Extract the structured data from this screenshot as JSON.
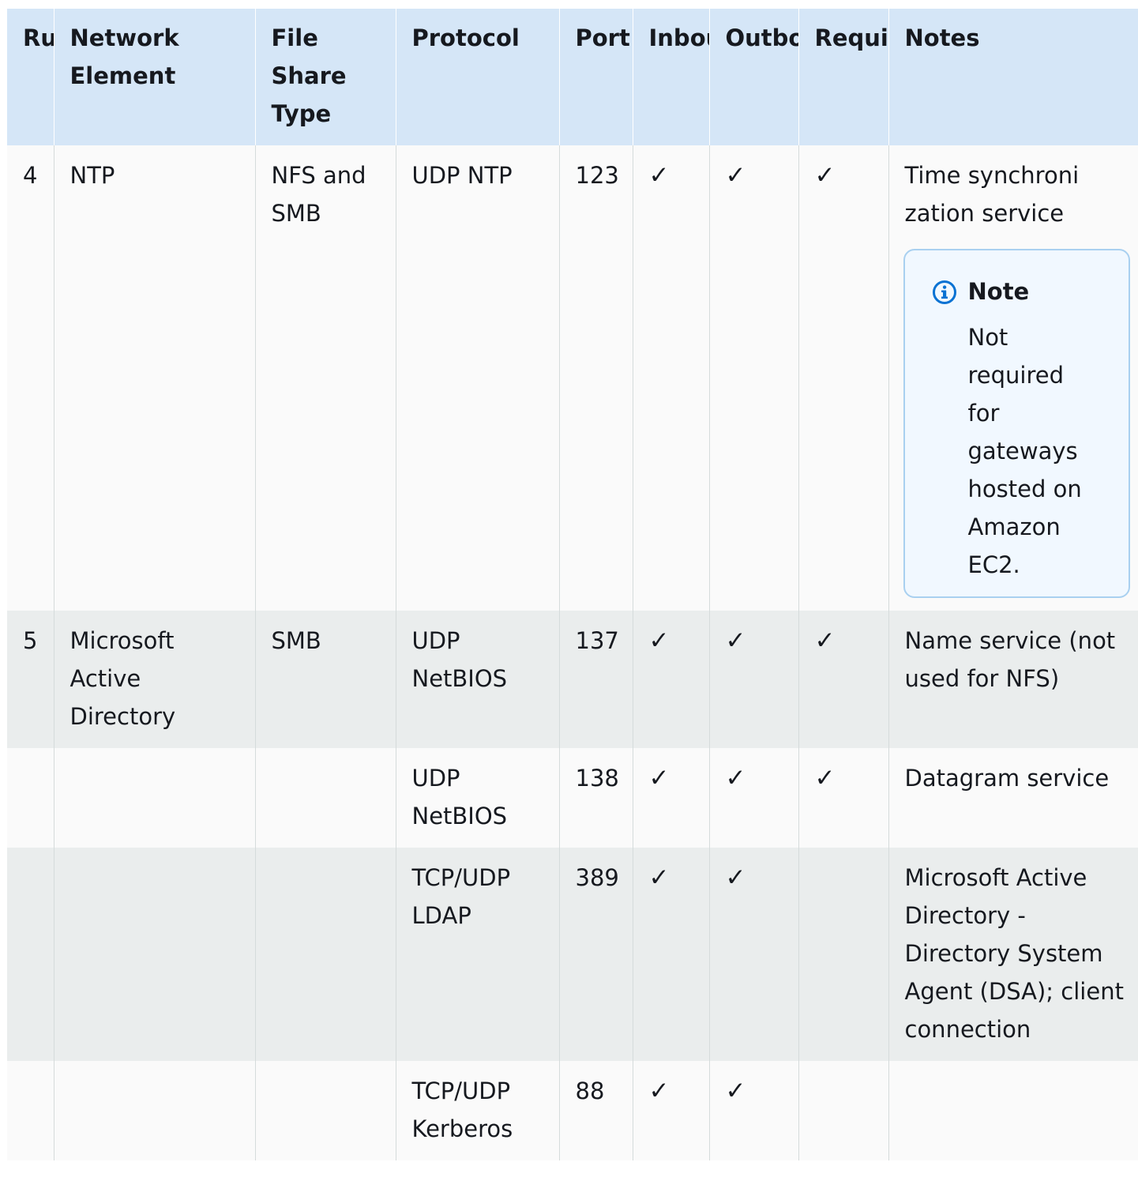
{
  "table": {
    "headers": [
      "Ru",
      "Network Element",
      "File Share Type",
      "Protocol",
      "Port",
      "Inbou",
      "Outbo",
      "Requi",
      "Notes"
    ],
    "rows": [
      {
        "rule": "4",
        "network_element": "NTP",
        "file_share_type": "NFS and SMB",
        "protocol": "UDP NTP",
        "port": "123",
        "inbound": "✓",
        "outbound": "✓",
        "required": "✓",
        "notes": "Time synchroni zation service"
      },
      {
        "rule": "5",
        "network_element": "Microsoft Active Directory",
        "file_share_type": "SMB",
        "protocol": "UDP NetBIOS",
        "port": "137",
        "inbound": "✓",
        "outbound": "✓",
        "required": "✓",
        "notes": "Name service (not used for NFS)"
      },
      {
        "rule": "",
        "network_element": "",
        "file_share_type": "",
        "protocol": "UDP NetBIOS",
        "port": "138",
        "inbound": "✓",
        "outbound": "✓",
        "required": "✓",
        "notes": "Datagram service"
      },
      {
        "rule": "",
        "network_element": "",
        "file_share_type": "",
        "protocol": "TCP/UDP LDAP",
        "port": "389",
        "inbound": "✓",
        "outbound": "✓",
        "required": "",
        "notes": "Microsoft Active Directory - Directory System Agent (DSA); client connection"
      },
      {
        "rule": "",
        "network_element": "",
        "file_share_type": "",
        "protocol": "TCP/UDP Kerberos",
        "port": "88",
        "inbound": "✓",
        "outbound": "✓",
        "required": "",
        "notes": ""
      }
    ],
    "note": {
      "icon": "info-icon",
      "title": "Note",
      "text": "Not required for gateways hosted on Amazon EC2."
    }
  },
  "colors": {
    "header_bg": "#d5e6f7",
    "row_light": "#fafafa",
    "row_dark": "#eaeded",
    "note_border": "#a9d0f0",
    "note_icon": "#0972d3"
  }
}
